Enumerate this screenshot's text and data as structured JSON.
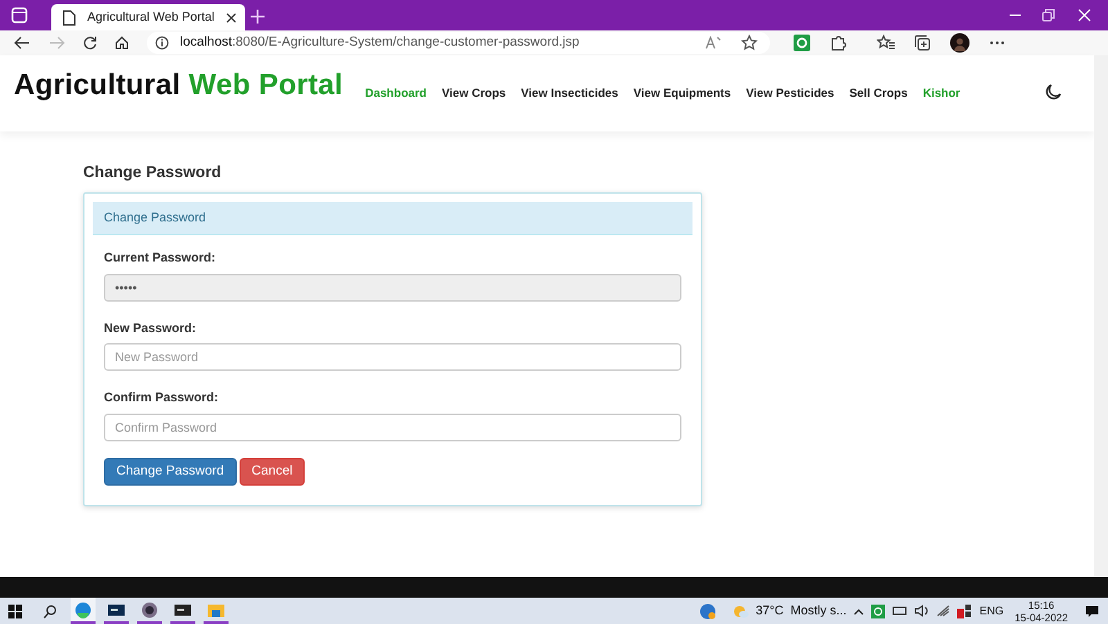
{
  "browser": {
    "tab_title": "Agricultural Web Portal",
    "url_host": "localhost",
    "url_rest": ":8080/E-Agriculture-System/change-customer-password.jsp"
  },
  "brand": {
    "dark_part": "Agricultural",
    "green_part": "Web Portal"
  },
  "nav_items": [
    {
      "label": "Dashboard",
      "selected": true
    },
    {
      "label": "View Crops",
      "selected": false
    },
    {
      "label": "View Insecticides",
      "selected": false
    },
    {
      "label": "View Equipments",
      "selected": false
    },
    {
      "label": "View Pesticides",
      "selected": false
    },
    {
      "label": "Sell Crops",
      "selected": false
    }
  ],
  "user": {
    "name": "Kishor"
  },
  "page_title": "Change Password",
  "panel": {
    "heading": "Change Password",
    "fields": [
      {
        "label": "Current Password:",
        "value": "•••••",
        "disabled": true
      },
      {
        "label": "New Password:",
        "placeholder": "New Password",
        "disabled": false
      },
      {
        "label": "Confirm Password:",
        "placeholder": "Confirm Password",
        "disabled": false
      }
    ],
    "buttons": [
      {
        "label": "Change Password",
        "kind": "primary"
      },
      {
        "label": "Cancel",
        "kind": "danger"
      }
    ]
  },
  "taskbar": {
    "apps": [
      {
        "kind": "edge",
        "selected": true
      },
      {
        "kind": "terminal",
        "selected": false
      },
      {
        "kind": "settings",
        "selected": false
      },
      {
        "kind": "console",
        "selected": false
      },
      {
        "kind": "folder",
        "selected": false
      }
    ],
    "temperature": "37°C",
    "weather": "Mostly s...",
    "language": "ENG",
    "time": "15:16",
    "date": "15-04-2022"
  }
}
